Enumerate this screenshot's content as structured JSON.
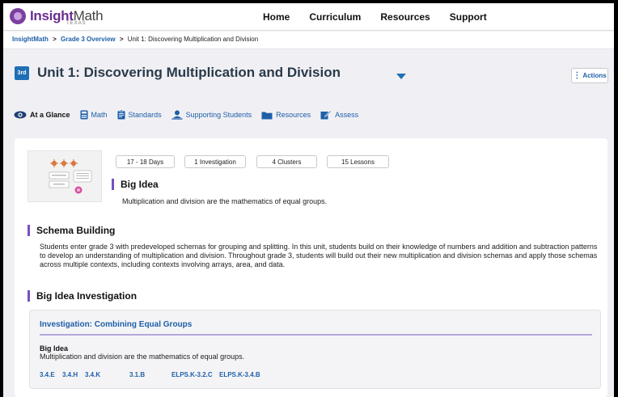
{
  "app": {
    "logo_brand": "Insight",
    "logo_math": "Math",
    "logo_sub": "TEXAS"
  },
  "nav": {
    "items": [
      {
        "label": "Home"
      },
      {
        "label": "Curriculum"
      },
      {
        "label": "Resources"
      },
      {
        "label": "Support"
      }
    ]
  },
  "breadcrumb": {
    "root": "InsightMath",
    "parent": "Grade 3 Overview",
    "current": "Unit 1: Discovering Multiplication and Division",
    "separator": ">"
  },
  "unit": {
    "grade_tag": "3rd",
    "title": "Unit 1: Discovering Multiplication and Division",
    "actions_label": "Actions"
  },
  "tabs": [
    {
      "label": "At a Glance",
      "icon": "eye-icon",
      "active": true
    },
    {
      "label": "Math",
      "icon": "calculator-icon"
    },
    {
      "label": "Standards",
      "icon": "clipboard-icon"
    },
    {
      "label": "Supporting Students",
      "icon": "person-icon"
    },
    {
      "label": "Resources",
      "icon": "folder-icon"
    },
    {
      "label": "Assess",
      "icon": "pen-check-icon"
    }
  ],
  "overview": {
    "pills": [
      "17 - 18 Days",
      "1 Investigation",
      "4 Clusters",
      "15 Lessons"
    ],
    "big_idea_heading": "Big Idea",
    "big_idea_text": "Multiplication and division are the mathematics of equal groups."
  },
  "schema": {
    "heading": "Schema Building",
    "text": "Students enter grade 3 with predeveloped schemas for grouping and splitting. In this unit, students build on their knowledge of numbers and addition and subtraction patterns to develop an understanding of multiplication and division. Throughout grade 3, students will build out their new multiplication and division schemas and apply those schemas across multiple contexts, including contexts involving arrays, area, and data."
  },
  "investigation": {
    "section_heading": "Big Idea Investigation",
    "title": "Investigation: Combining Equal Groups",
    "big_idea_label": "Big Idea",
    "big_idea_text": "Multiplication and division are the mathematics of equal groups.",
    "standards": [
      "3.4.E",
      "3.4.H",
      "3.4.K",
      "3.1.B",
      "ELPS.K-3.2.C",
      "ELPS.K-3.4.B"
    ]
  },
  "colors": {
    "brand_purple": "#6a2e8f",
    "link_blue": "#1e5fa8",
    "accent_bar": "#7a4fc2",
    "grade_tag": "#1f6fb5"
  }
}
